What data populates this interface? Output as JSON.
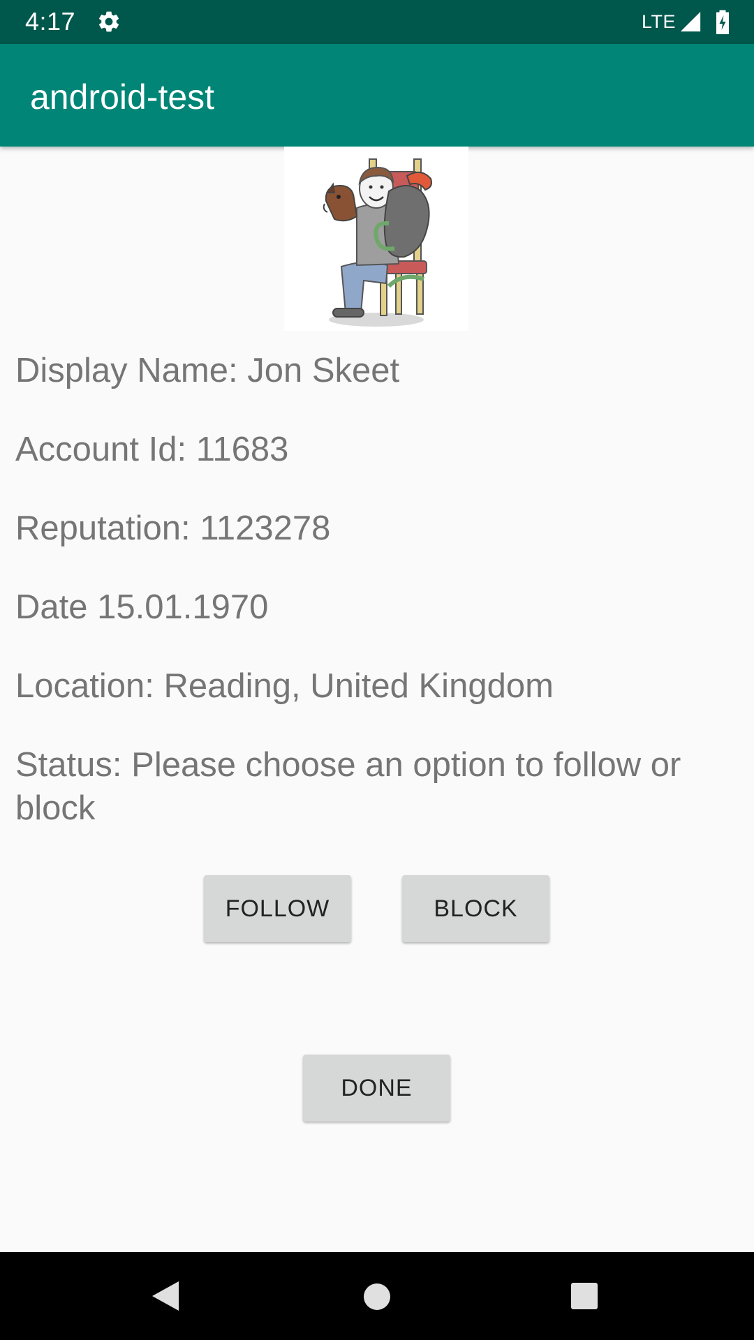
{
  "status_bar": {
    "time": "4:17",
    "network": "LTE",
    "icons": [
      "gear-icon",
      "signal-icon",
      "battery-icon"
    ]
  },
  "app_bar": {
    "title": "android-test",
    "color": "#008577"
  },
  "profile": {
    "display_name": "Display Name: Jon Skeet",
    "account_id": "Account Id: 11683",
    "reputation": "Reputation: 1123278",
    "date": "Date 15.01.1970",
    "location": "Location: Reading, United Kingdom",
    "status": "Status: Please choose an option to follow or block"
  },
  "buttons": {
    "follow": "FOLLOW",
    "block": "BLOCK",
    "done": "DONE"
  },
  "navigation": {
    "icons": [
      "back-icon",
      "home-icon",
      "recents-icon"
    ]
  }
}
